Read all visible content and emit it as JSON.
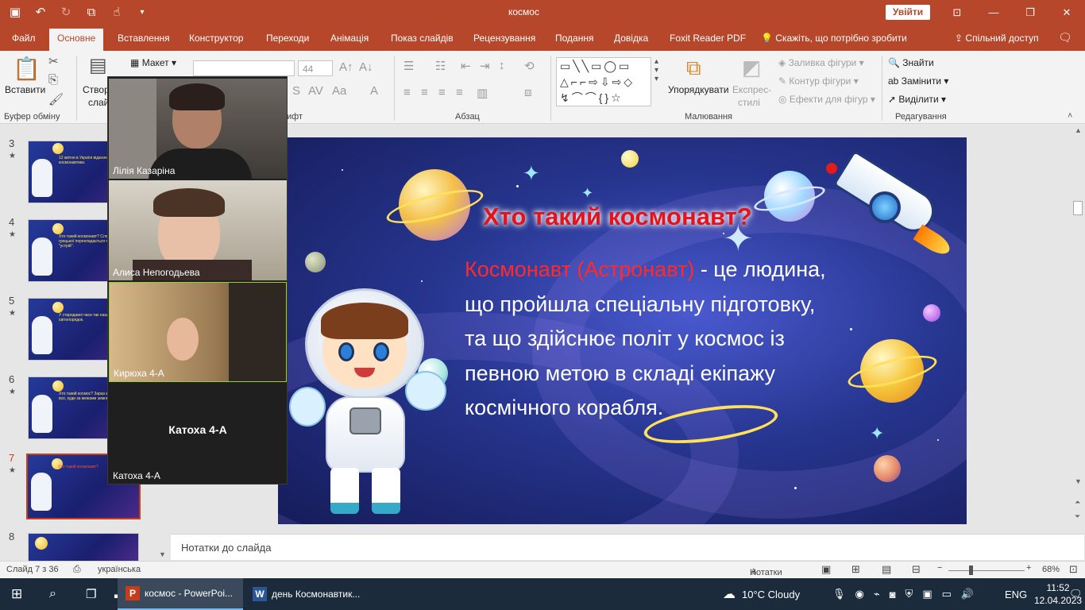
{
  "window": {
    "title": "космос",
    "signin": "Увійти"
  },
  "tabs": [
    "Файл",
    "Основне",
    "Вставлення",
    "Конструктор",
    "Переходи",
    "Анімація",
    "Показ слайдів",
    "Рецензування",
    "Подання",
    "Довідка",
    "Foxit Reader PDF"
  ],
  "tell_me": "Скажіть, що потрібно зробити",
  "share": "Спільний доступ",
  "ribbon": {
    "paste": "Вставити",
    "clipboard_label": "Буфер обміну",
    "create_slide": "Створ",
    "create_slide_2": "слай",
    "layout": "Макет",
    "font_label": "ифт",
    "font_size": "44",
    "paragraph_label": "Абзац",
    "arrange": "Упорядкувати",
    "quick_styles_1": "Експрес-",
    "quick_styles_2": "стилі",
    "shape_fill": "Заливка фігури",
    "shape_outline": "Контур фігури",
    "shape_effects": "Ефекти для фігур",
    "drawing_label": "Малювання",
    "find": "Знайти",
    "replace": "Замінити",
    "select": "Виділити",
    "editing_label": "Редагування"
  },
  "thumbnails": [
    {
      "num": "3",
      "text": "12 квітня в Україні відзначають День космонавтики."
    },
    {
      "num": "4",
      "text": "Хто такий космонавт? Слово \"космос\" з грецької перекладається як \"порядок\", \"устрій\"."
    },
    {
      "num": "5",
      "text": "У стародавні часи так називали світопорядок."
    },
    {
      "num": "6",
      "text": "Хто такий космос? Зараз космос — це все, куди за межами земної атмосфери."
    },
    {
      "num": "7",
      "text": "Хто такий космонавт?"
    },
    {
      "num": "8",
      "text": ""
    }
  ],
  "participants": [
    {
      "name": "Лілія Казаріна"
    },
    {
      "name": "Алиса Непогодьева"
    },
    {
      "name": "Кирюха 4-А"
    },
    {
      "name": "Катоха 4-А",
      "center": "Катоха 4-А"
    }
  ],
  "slide": {
    "title": "Хто такий космонавт?",
    "term": "Космонавт (Астронавт)",
    "definition": " - це людина, що пройшла спеціальну підготовку, та що здійснює політ у космос із певною метою в складі екіпажу космічного корабля."
  },
  "notes_placeholder": "Нотатки до слайда",
  "status": {
    "slide_counter": "Слайд 7 з 36",
    "language": "українська",
    "notes": "Нотатки",
    "zoom": "68%"
  },
  "taskbar": {
    "apps": [
      "космос - PowerPoi...",
      "день Космонавтик..."
    ],
    "weather": "10°C  Cloudy",
    "lang": "ENG",
    "time": "11:52",
    "date": "12.04.2023"
  },
  "colors": {
    "accent": "#b7472a",
    "title_red": "#e4131b",
    "selected_border": "#c43e1c"
  }
}
